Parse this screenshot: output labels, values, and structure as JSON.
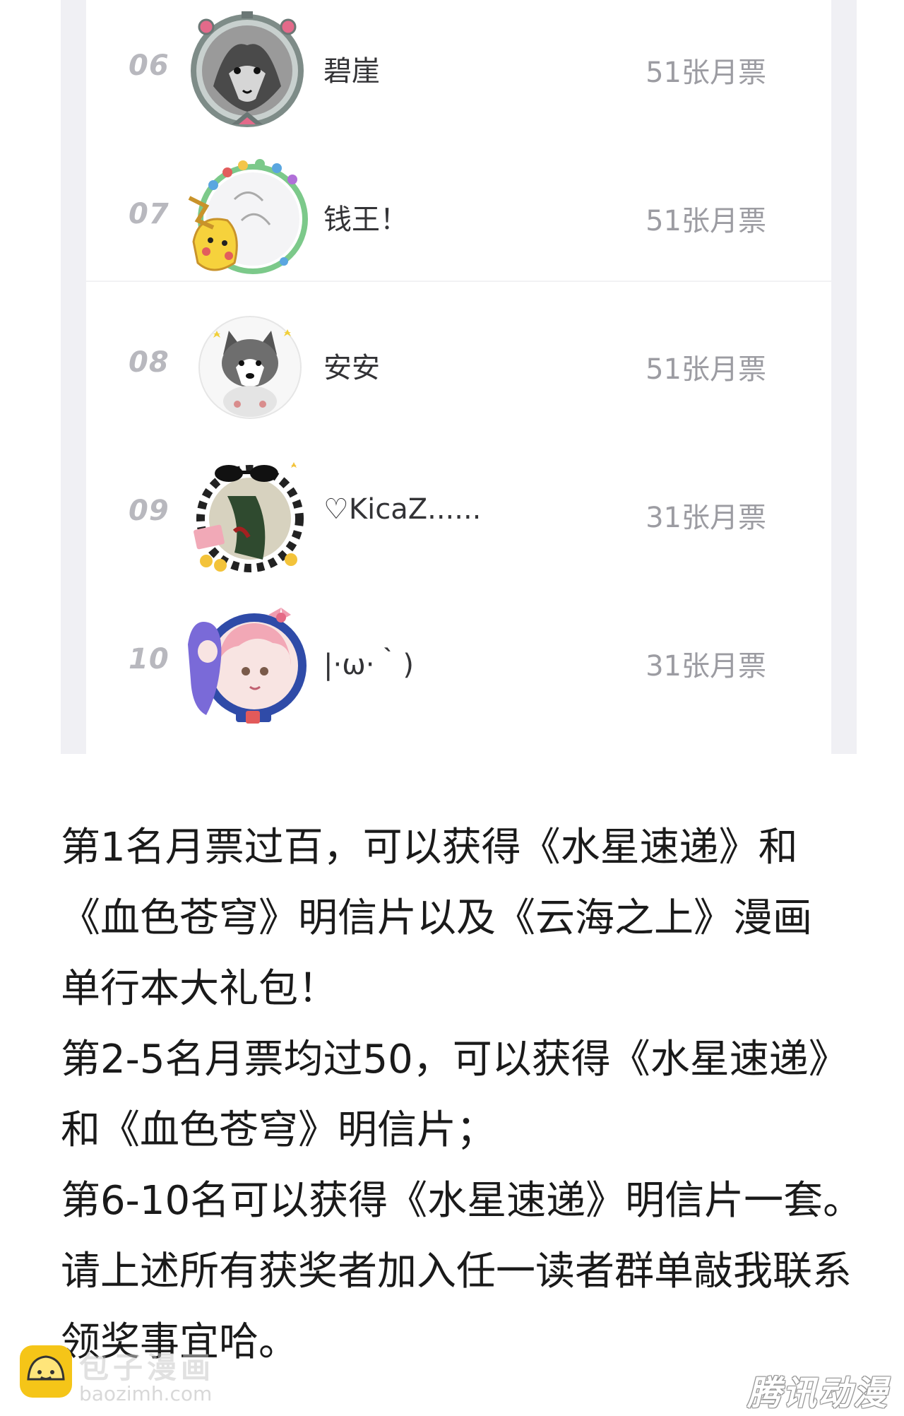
{
  "ranking": {
    "rows": [
      {
        "rank": "06",
        "name": "碧崖",
        "votes": "51张月票",
        "avatar": "wolf-avatar"
      },
      {
        "rank": "07",
        "name": "钱王！",
        "votes": "51张月票",
        "avatar": "pikachu-avatar"
      },
      {
        "rank": "08",
        "name": "安安",
        "votes": "51张月票",
        "avatar": "husky-avatar"
      },
      {
        "rank": "09",
        "name": "♡KicaZ......",
        "votes": "31张月票",
        "avatar": "sunglasses-avatar"
      },
      {
        "rank": "10",
        "name": "|·ω·｀)",
        "votes": "31张月票",
        "avatar": "anime-girl-avatar"
      }
    ]
  },
  "announcement": {
    "lines": [
      "第1名月票过百，可以获得《水星速递》和",
      "《血色苍穹》明信片以及《云海之上》漫画",
      "单行本大礼包！",
      "第2-5名月票均过50，可以获得《水星速递》",
      "和《血色苍穹》明信片；",
      "第6-10名可以获得《水星速递》明信片一套。",
      "请上述所有获奖者加入任一读者群单敲我联系",
      "领奖事宜哈。"
    ]
  },
  "watermarks": {
    "left_title": "包子漫画",
    "left_url": "baozimh.com",
    "right_text": "腾讯动漫"
  },
  "colors": {
    "rank": "#b8b8be",
    "votes": "#9c9ca2",
    "name": "#333336",
    "body_text": "#1a1a1a"
  }
}
